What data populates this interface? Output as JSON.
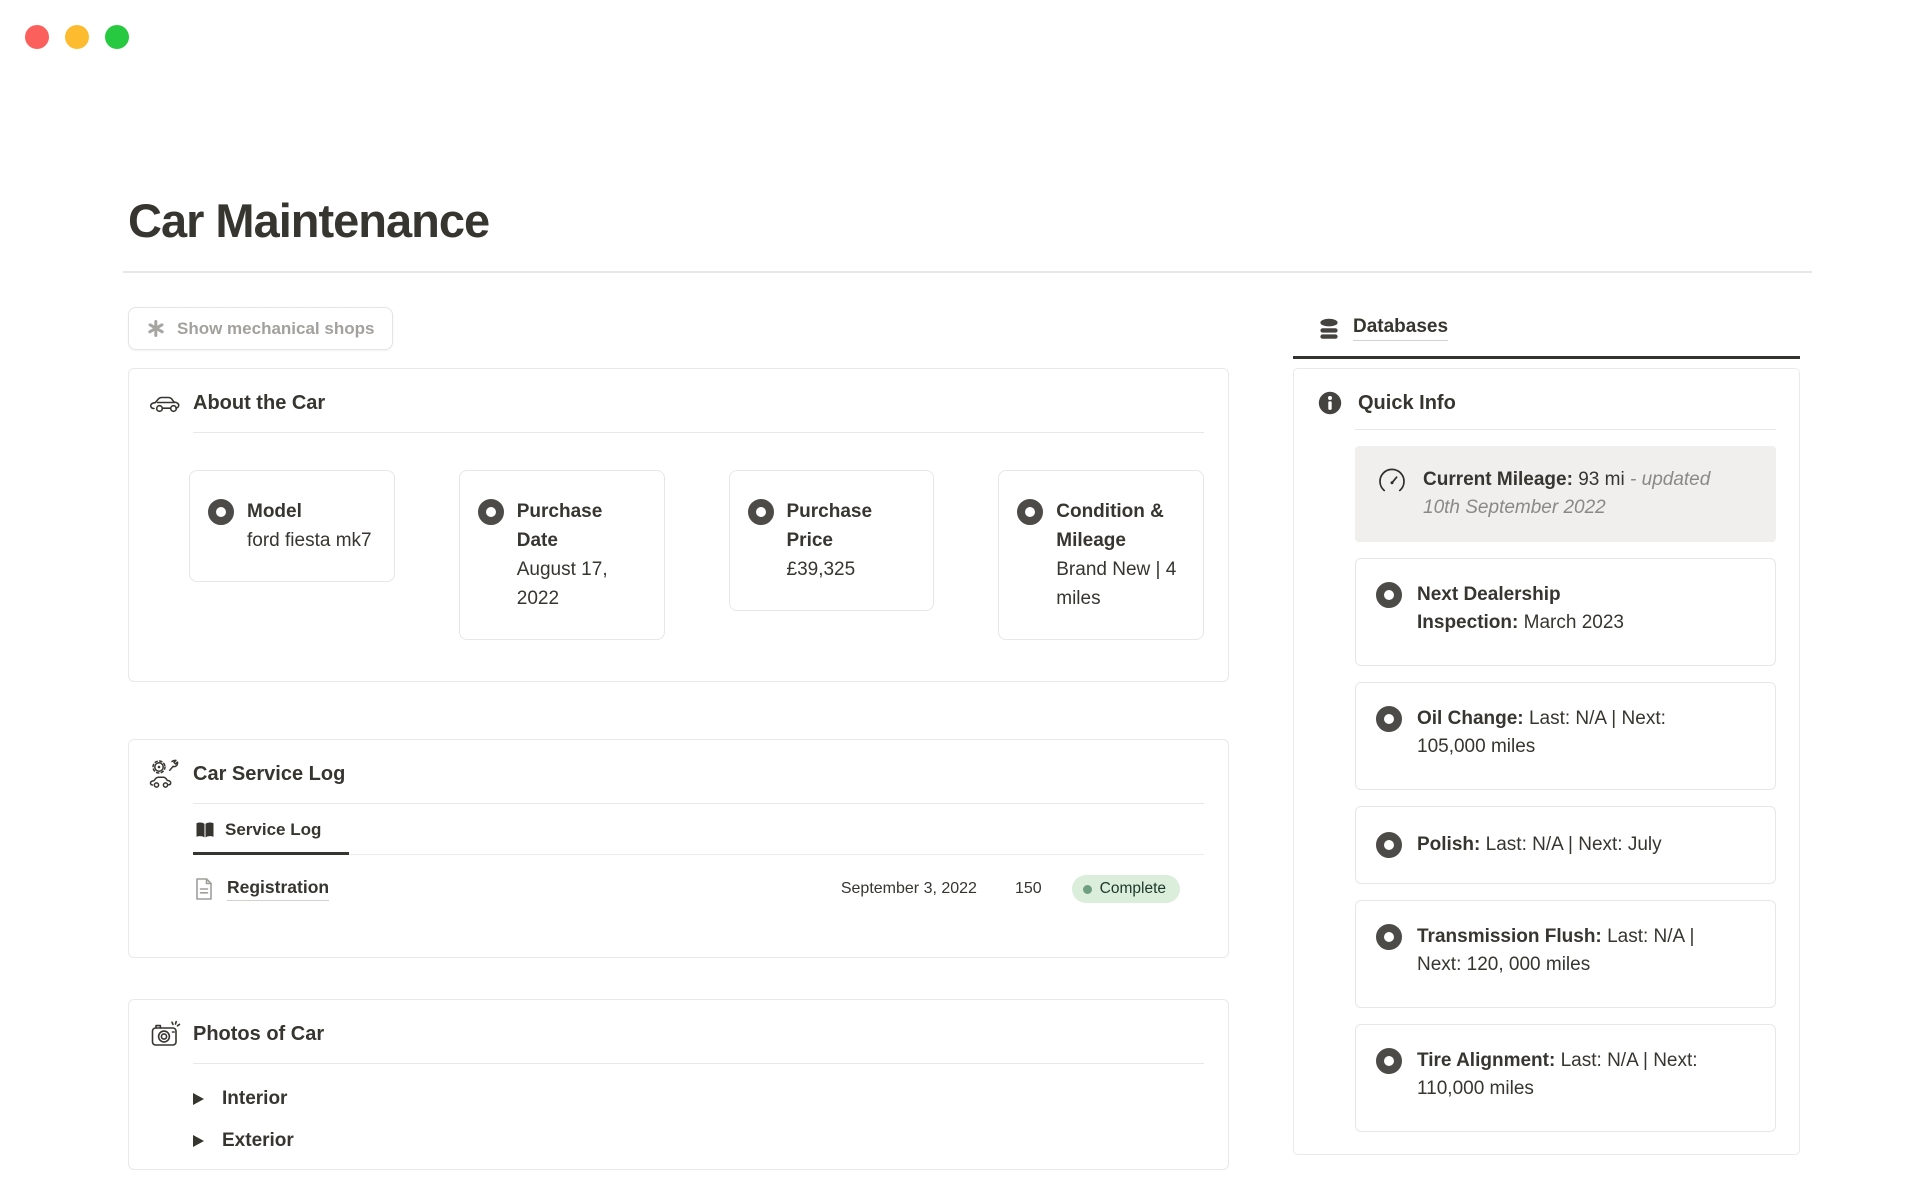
{
  "window": {
    "controls": [
      {
        "name": "close",
        "color": "#fc605c"
      },
      {
        "name": "minimize",
        "color": "#fdbc2f"
      },
      {
        "name": "zoom",
        "color": "#26c940"
      }
    ]
  },
  "page": {
    "title": "Car Maintenance"
  },
  "actions": {
    "show_shops": {
      "icon": "asterisk-icon",
      "label": "Show mechanical shops"
    }
  },
  "about_card": {
    "icon": "car-icon",
    "title": "About the Car",
    "items": [
      {
        "icon": "record-circle-icon",
        "label": "Model",
        "value": "ford fiesta mk7"
      },
      {
        "icon": "record-circle-icon",
        "label": "Purchase Date",
        "value": "August 17, 2022"
      },
      {
        "icon": "record-circle-icon",
        "label": "Purchase Price",
        "value": "£39,325"
      },
      {
        "icon": "record-circle-icon",
        "label": "Condition & Mileage",
        "value": "Brand New | 4 miles"
      }
    ]
  },
  "service_card": {
    "icon": "car-repair-icon",
    "title": "Car Service Log",
    "tabs": [
      {
        "icon": "book-icon",
        "label": "Service Log",
        "active": true
      }
    ],
    "rows": [
      {
        "icon": "page-icon",
        "title": "Registration",
        "date": "September 3, 2022",
        "value": "150",
        "status": "Complete"
      }
    ]
  },
  "photos_card": {
    "icon": "camera-icon",
    "title": "Photos of Car",
    "toggles": [
      {
        "icon": "triangle-right-icon",
        "label": "Interior"
      },
      {
        "icon": "triangle-right-icon",
        "label": "Exterior"
      }
    ]
  },
  "sidebar": {
    "database_link": {
      "icon": "database-icon",
      "label": "Databases"
    },
    "quick_info": {
      "icon": "info-icon",
      "title": "Quick Info",
      "callout": {
        "icon": "gauge-icon",
        "label": "Current Mileage:",
        "value": "93 mi",
        "note": "- updated 10th September 2022",
        "bg": "#f1efee"
      },
      "items": [
        {
          "icon": "record-circle-icon",
          "label": "Next Dealership Inspection:",
          "value": "March 2023"
        },
        {
          "icon": "record-circle-icon",
          "label": "Oil Change:",
          "value": "Last: N/A | Next: 105,000 miles"
        },
        {
          "icon": "record-circle-icon",
          "label": "Polish:",
          "value": "Last: N/A | Next: July"
        },
        {
          "icon": "record-circle-icon",
          "label": "Transmission Flush:",
          "value": "Last: N/A | Next: 120, 000 miles"
        },
        {
          "icon": "record-circle-icon",
          "label": "Tire Alignment:",
          "value": "Last: N/A | Next: 110,000 miles"
        }
      ]
    }
  },
  "colors": {
    "text": "#37352f",
    "secondary_text": "#a3a19d",
    "card_border": "#e9e9e7",
    "badge_bg": "#dbeddb",
    "badge_dot": "#6f9e80",
    "badge_text": "#1c3829",
    "callout_bg": "#f1efee",
    "dark_rule": "#34322e",
    "traffic_red": "#fc605c",
    "traffic_yellow": "#fdbc2f",
    "traffic_green": "#26c940"
  }
}
